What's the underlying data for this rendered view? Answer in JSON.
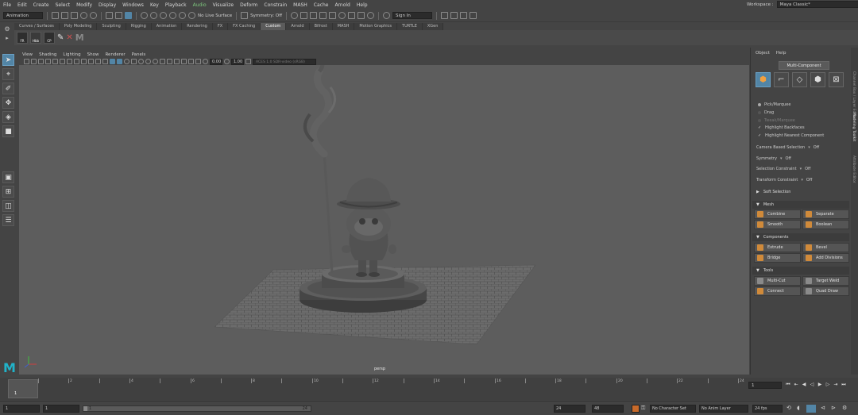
{
  "menubar": {
    "items": [
      "File",
      "Edit",
      "Create",
      "Select",
      "Modify",
      "Display",
      "Windows",
      "Key",
      "Playback",
      "Audio",
      "Visualize",
      "Deform",
      "Constrain",
      "MASH",
      "Cache",
      "Arnold",
      "Help"
    ],
    "workspace_label": "Workspace :",
    "workspace_value": "Maya Classic*"
  },
  "statusline": {
    "menuset": "Animation",
    "live_surface": "No Live Surface",
    "symmetry": "Symmetry: Off",
    "sign_in": "Sign In"
  },
  "shelf": {
    "tabs": [
      "Curves / Surfaces",
      "Poly Modeling",
      "Sculpting",
      "Rigging",
      "Animation",
      "Rendering",
      "FX",
      "FX Caching",
      "Custom",
      "Arnold",
      "Bifrost",
      "MASH",
      "Motion Graphics",
      "TURTLE",
      "XGen"
    ],
    "active_tab": "Custom",
    "buttons": [
      "FR",
      "Hbb",
      "CP"
    ]
  },
  "panel": {
    "menus": [
      "View",
      "Shading",
      "Lighting",
      "Show",
      "Renderer",
      "Panels"
    ],
    "near_clip": "0.00",
    "far_clip": "1.00",
    "colorspace": "ACES 1.0 SDR-video (sRGB)",
    "camera_label": "persp"
  },
  "attr": {
    "menus": [
      "Object",
      "Help"
    ],
    "mode_button": "Multi-Component",
    "pick": "Pick/Marquee",
    "drag": "Drag",
    "tweak": "Tweak/Marquee",
    "highlight_backfaces": "Highlight Backfaces",
    "highlight_nearest": "Highlight Nearest Component",
    "camera_selection": "Camera Based Selection",
    "camera_selection_val": "Off",
    "symmetry": "Symmetry",
    "symmetry_val": "Off",
    "sel_constraint": "Selection Constraint",
    "sel_constraint_val": "Off",
    "xform_constraint": "Transform Constraint",
    "xform_constraint_val": "Off",
    "soft_selection": "Soft Selection",
    "sec_mesh": "Mesh",
    "combine": "Combine",
    "separate": "Separate",
    "smooth": "Smooth",
    "boolean": "Boolean",
    "sec_components": "Components",
    "extrude": "Extrude",
    "bevel": "Bevel",
    "bridge": "Bridge",
    "add_divisions": "Add Divisions",
    "sec_tools": "Tools",
    "multi_cut": "Multi-Cut",
    "target_weld": "Target Weld",
    "connect": "Connect",
    "quad_draw": "Quad Draw"
  },
  "right_strip": [
    "Channel Box / Layer Editor",
    "Modeling Toolkit",
    "Attribute Editor"
  ],
  "timeslider": {
    "current_frame": "1",
    "ticks": [
      "2",
      "4",
      "6",
      "8",
      "10",
      "12",
      "14",
      "16",
      "18",
      "20",
      "22",
      "24"
    ],
    "frame_field": "1"
  },
  "rangebar": {
    "start": "1",
    "anim_start": "1",
    "range_left": "1",
    "range_right": "24",
    "end": "24",
    "anim_end": "48",
    "character_set": "No Character Set",
    "anim_layer": "No Anim Layer",
    "fps": "24 fps"
  },
  "colors": {
    "accent": "#5285a6",
    "viewport": "#5d5d5d",
    "maya_logo": "#21b3c9"
  }
}
